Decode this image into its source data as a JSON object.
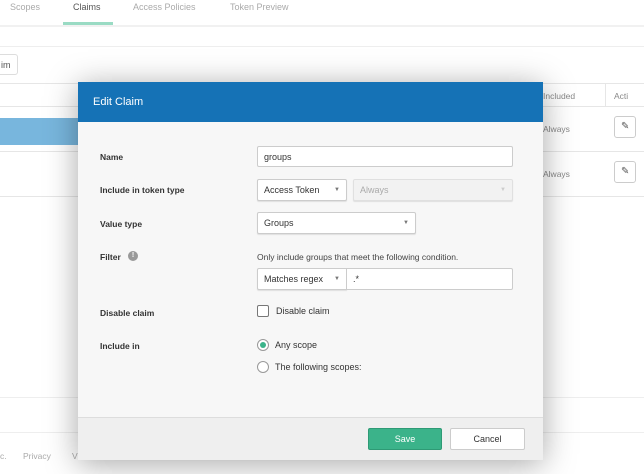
{
  "tabs": [
    "Scopes",
    "Claims",
    "Access Policies",
    "Token Preview"
  ],
  "background": {
    "add_button_partial": "im",
    "table_headers": [
      "Included",
      "Acti"
    ],
    "rows": [
      {
        "included": "Always"
      },
      {
        "included": "Always"
      }
    ],
    "footer_links": [
      "c.",
      "Privacy",
      "V"
    ]
  },
  "modal": {
    "title": "Edit Claim",
    "name_label": "Name",
    "name_value": "groups",
    "token_type_label": "Include in token type",
    "token_type_value": "Access Token",
    "token_when_value": "Always",
    "value_type_label": "Value type",
    "value_type_value": "Groups",
    "filter_label": "Filter",
    "filter_help": "Only include groups that meet the following condition.",
    "filter_op": "Matches regex",
    "filter_value": ".*",
    "disable_label": "Disable claim",
    "disable_checkbox_label": "Disable claim",
    "disable_checked": false,
    "include_in_label": "Include in",
    "include_options": [
      "Any scope",
      "The following scopes:"
    ],
    "include_selected": 0,
    "save": "Save",
    "cancel": "Cancel"
  },
  "colors": {
    "header": "#1572b6",
    "save": "#3bb38a",
    "tab_active": "#9adbc4"
  }
}
